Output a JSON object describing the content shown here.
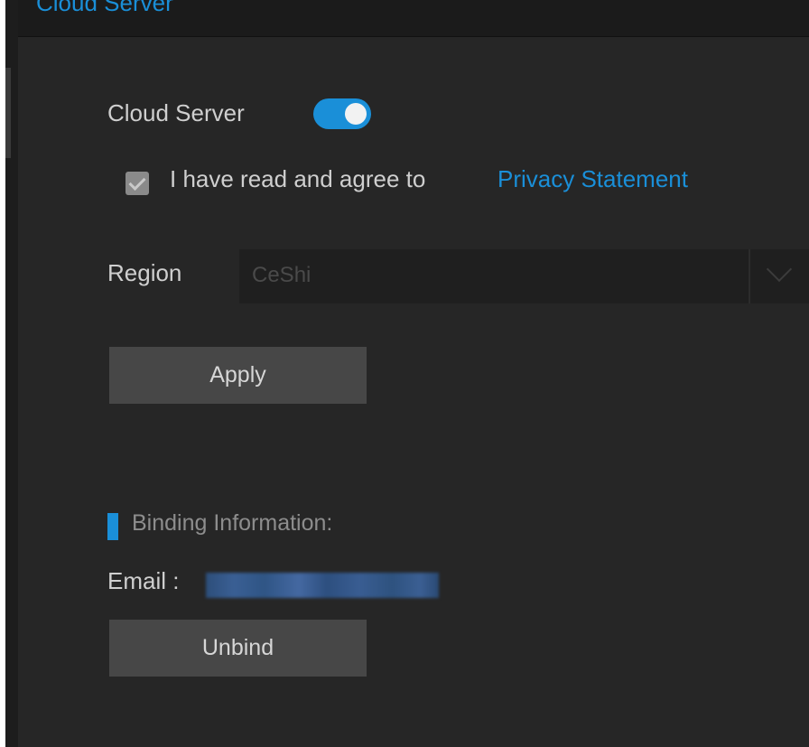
{
  "header": {
    "title": "Cloud Server"
  },
  "cloud_server": {
    "label": "Cloud Server",
    "enabled": true
  },
  "agreement": {
    "checked": true,
    "text": "I have read and agree to",
    "link_text": "Privacy Statement"
  },
  "region": {
    "label": "Region",
    "value": "CeShi"
  },
  "apply_button": {
    "label": "Apply"
  },
  "binding": {
    "title": "Binding Information:",
    "email_label": "Email :",
    "email_value": "",
    "unbind_label": "Unbind"
  },
  "icons": {
    "select_arrow": "chevron-down-icon",
    "checkbox": "check-icon"
  },
  "colors": {
    "accent": "#1a8fd8",
    "background": "#262626",
    "button": "#474747"
  }
}
